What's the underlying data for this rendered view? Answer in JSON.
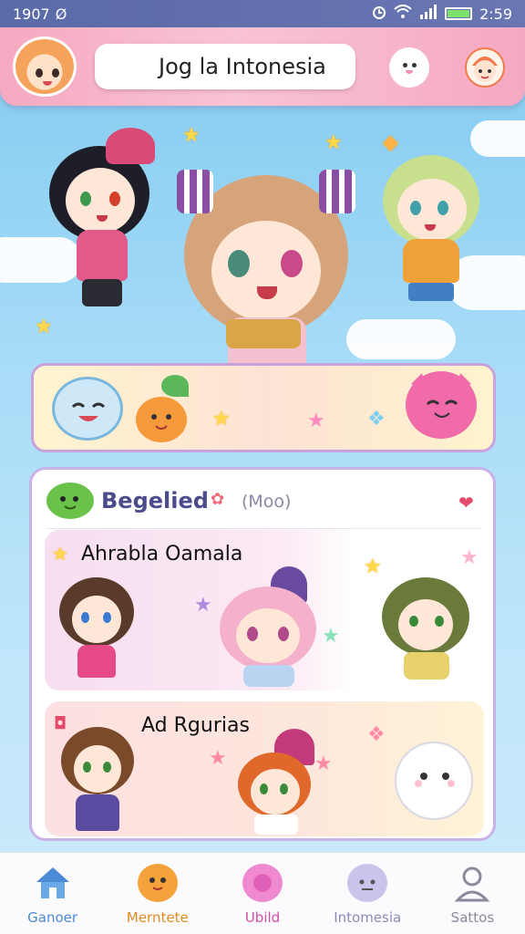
{
  "status_bar": {
    "time_left": "1907",
    "sync_glyph": "Ø",
    "time_right": "2:59",
    "icons": [
      "alarm-icon",
      "wifi-icon",
      "signal-icon",
      "battery-icon"
    ]
  },
  "header": {
    "search_value": "Jog la Intonesia",
    "avatar_icon": "girl-avatar-icon",
    "icons": [
      "ghost-icon",
      "mascot-icon"
    ]
  },
  "card": {
    "title": "Begelied",
    "subtitle": "(Moo)",
    "rows": [
      {
        "label": "Ahrabla Oamala"
      },
      {
        "label": "Ad Rgurias"
      }
    ]
  },
  "bottom_nav": {
    "items": [
      {
        "label": "Ganoer",
        "icon": "home-icon",
        "color": "#4a8ad6"
      },
      {
        "label": "Merntete",
        "icon": "orange-mascot-icon",
        "color": "#e08a1e"
      },
      {
        "label": "Ubild",
        "icon": "pink-blob-icon",
        "color": "#d64aa8"
      },
      {
        "label": "Intomesia",
        "icon": "purple-cat-icon",
        "color": "#8a8ab8"
      },
      {
        "label": "Sattos",
        "icon": "person-icon",
        "color": "#8a8a9a"
      }
    ]
  },
  "colors": {
    "header_pink": "#f6a9c1",
    "status_bar": "#5a6aa8",
    "card_border": "#c9b2e8"
  }
}
